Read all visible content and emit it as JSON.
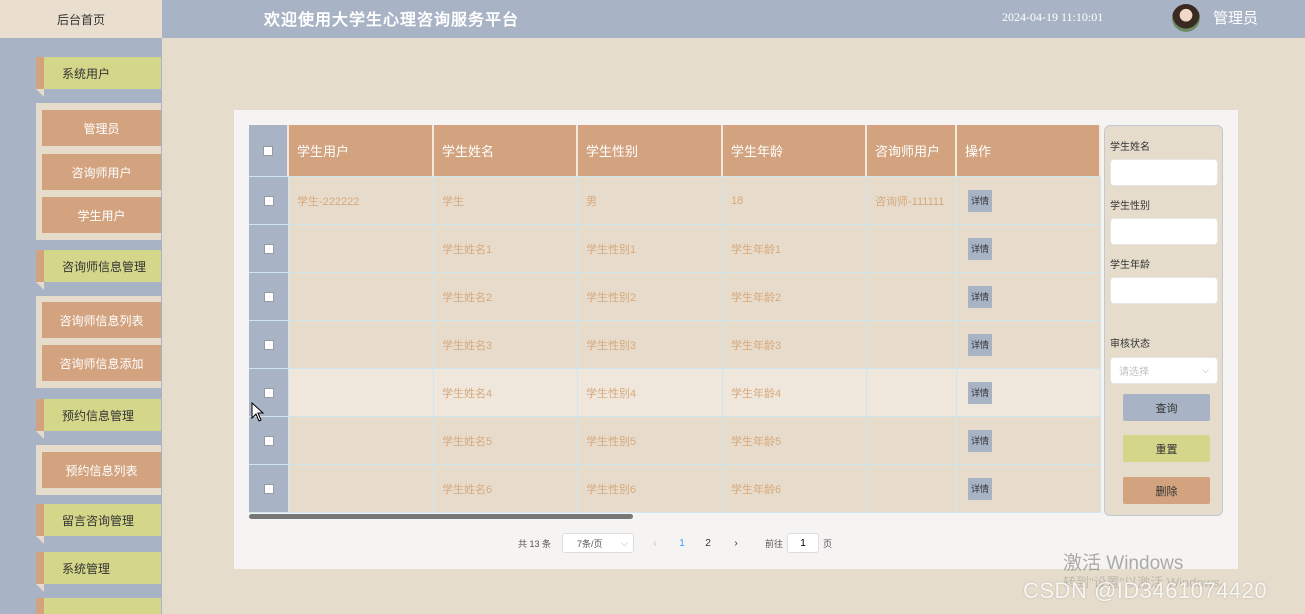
{
  "header": {
    "home": "后台首页",
    "title": "欢迎使用大学生心理咨询服务平台",
    "datetime": "2024-04-19 11:10:01",
    "user": "管理员"
  },
  "sidebar": {
    "menus": [
      {
        "label": "系统用户",
        "children": [
          "管理员",
          "咨询师用户",
          "学生用户"
        ]
      },
      {
        "label": "咨询师信息管理",
        "children": [
          "咨询师信息列表",
          "咨询师信息添加"
        ]
      },
      {
        "label": "预约信息管理",
        "children": [
          "预约信息列表"
        ]
      },
      {
        "label": "留言咨询管理",
        "children": []
      },
      {
        "label": "系统管理",
        "children": []
      }
    ]
  },
  "table": {
    "columns": [
      "学生用户",
      "学生姓名",
      "学生性别",
      "学生年龄",
      "咨询师用户",
      "操作"
    ],
    "action_label": "详情",
    "rows": [
      [
        "学生-222222",
        "学生",
        "男",
        "18",
        "咨询师-111111"
      ],
      [
        "",
        "学生姓名1",
        "学生性别1",
        "学生年龄1",
        ""
      ],
      [
        "",
        "学生姓名2",
        "学生性别2",
        "学生年龄2",
        ""
      ],
      [
        "",
        "学生姓名3",
        "学生性别3",
        "学生年龄3",
        ""
      ],
      [
        "",
        "学生姓名4",
        "学生性别4",
        "学生年龄4",
        ""
      ],
      [
        "",
        "学生姓名5",
        "学生性别5",
        "学生年龄5",
        ""
      ],
      [
        "",
        "学生姓名6",
        "学生性别6",
        "学生年龄6",
        ""
      ]
    ]
  },
  "search": {
    "name_label": "学生姓名",
    "gender_label": "学生性别",
    "age_label": "学生年龄",
    "status_label": "审核状态",
    "status_placeholder": "请选择",
    "query_button": "查询",
    "reset_button": "重置",
    "delete_button": "删除",
    "colors": {
      "query": "#a8b3c6",
      "reset": "#d4d78a",
      "delete": "#d3a37f"
    }
  },
  "pagination": {
    "total": "共 13 条",
    "page_size": "7条/页",
    "pages": [
      "1",
      "2"
    ],
    "current": "1",
    "goto_prefix": "前往",
    "goto_value": "1",
    "goto_suffix": "页"
  },
  "watermarks": {
    "activate": "激活 Windows",
    "activate_sub": "转到\"设置\"以激活 Windows。",
    "csdn": "CSDN @ID3461074420"
  }
}
